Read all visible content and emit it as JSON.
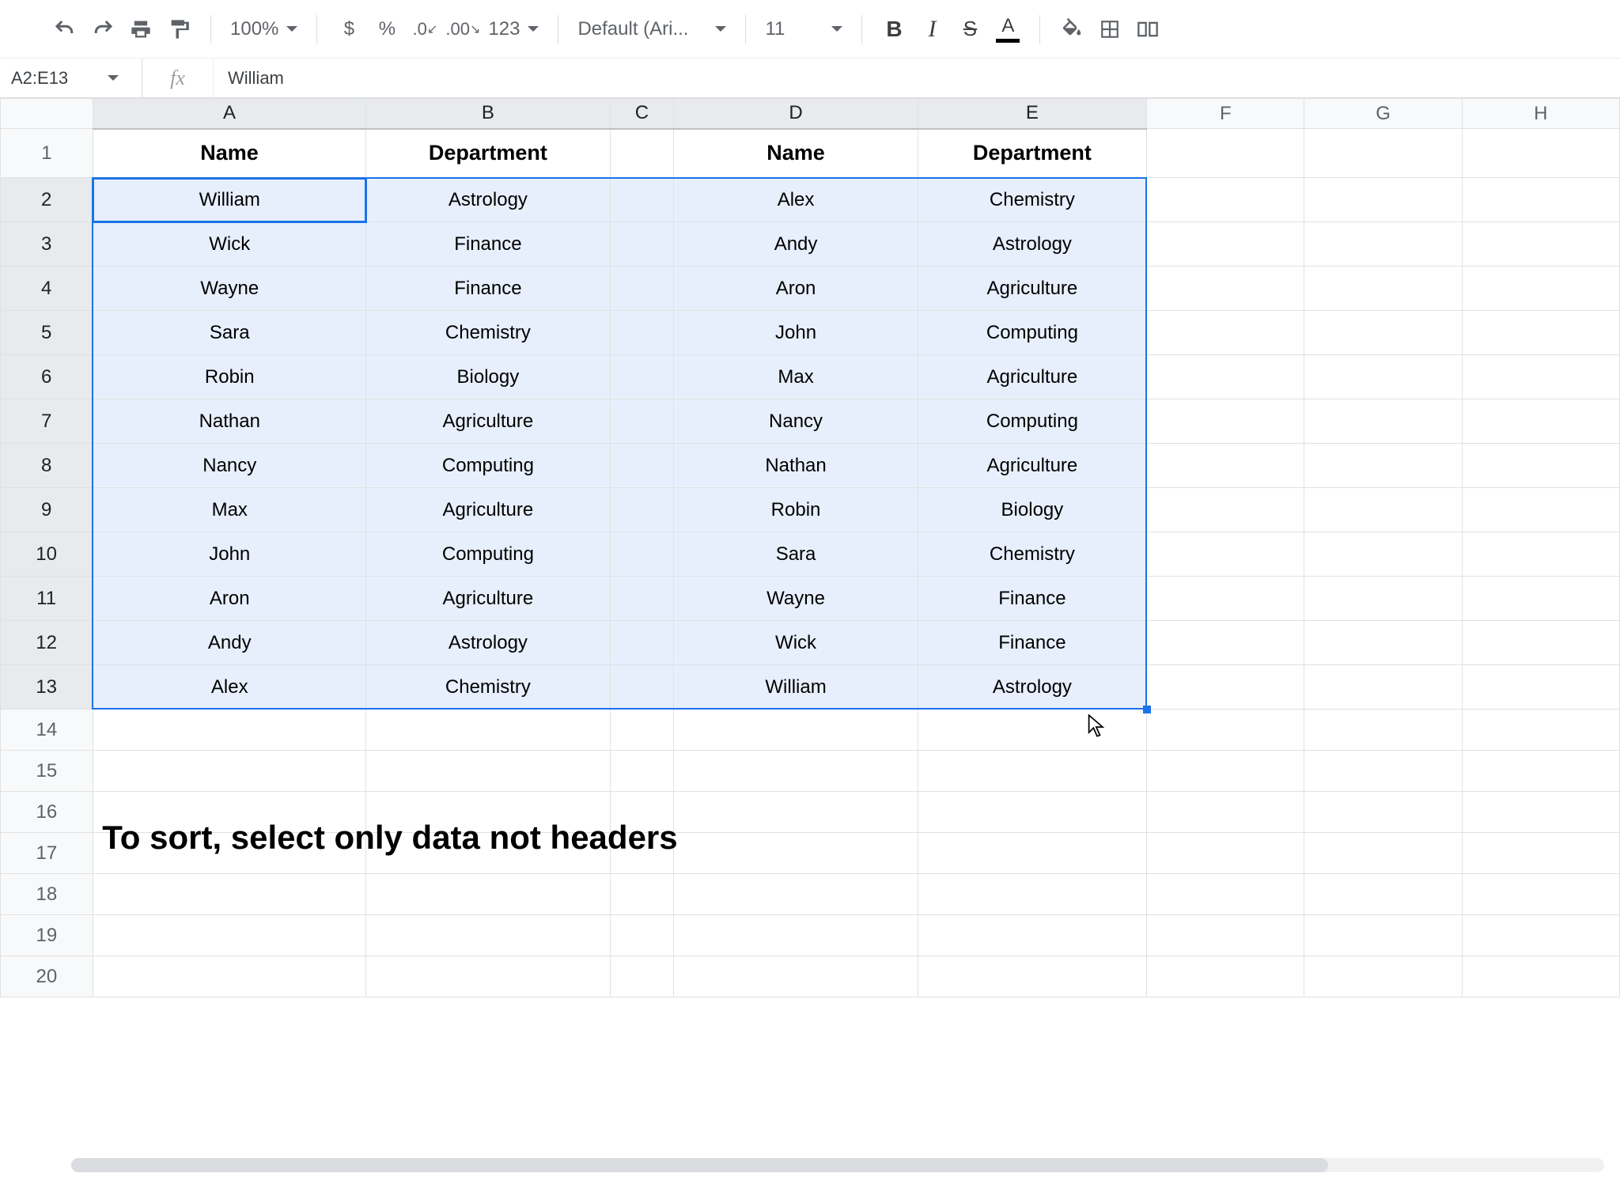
{
  "toolbar": {
    "zoom": "100%",
    "font": "Default (Ari...",
    "font_size": "11",
    "currency_symbol": "$",
    "percent_symbol": "%",
    "number_format_label": "123"
  },
  "namebox": {
    "value": "A2:E13"
  },
  "formula": {
    "value": "William",
    "fx": "fx"
  },
  "columns": [
    "A",
    "B",
    "C",
    "D",
    "E",
    "F",
    "G",
    "H"
  ],
  "column_widths": [
    "col-A",
    "col-B",
    "col-C",
    "col-D",
    "col-E",
    "col-rest",
    "col-rest",
    "col-rest"
  ],
  "selected_cols": [
    "A",
    "B",
    "C",
    "D",
    "E"
  ],
  "row_count": 20,
  "selected_rows": [
    2,
    3,
    4,
    5,
    6,
    7,
    8,
    9,
    10,
    11,
    12,
    13
  ],
  "active_cell": {
    "row": 2,
    "col": "A"
  },
  "headers_row": 1,
  "headers": {
    "A": "Name",
    "B": "Department",
    "D": "Name",
    "E": "Department"
  },
  "data": {
    "2": {
      "A": "William",
      "B": "Astrology",
      "D": "Alex",
      "E": "Chemistry"
    },
    "3": {
      "A": "Wick",
      "B": "Finance",
      "D": "Andy",
      "E": "Astrology"
    },
    "4": {
      "A": "Wayne",
      "B": "Finance",
      "D": "Aron",
      "E": "Agriculture"
    },
    "5": {
      "A": "Sara",
      "B": "Chemistry",
      "D": "John",
      "E": "Computing"
    },
    "6": {
      "A": "Robin",
      "B": "Biology",
      "D": "Max",
      "E": "Agriculture"
    },
    "7": {
      "A": "Nathan",
      "B": "Agriculture",
      "D": "Nancy",
      "E": "Computing"
    },
    "8": {
      "A": "Nancy",
      "B": "Computing",
      "D": "Nathan",
      "E": "Agriculture"
    },
    "9": {
      "A": "Max",
      "B": "Agriculture",
      "D": "Robin",
      "E": "Biology"
    },
    "10": {
      "A": "John",
      "B": "Computing",
      "D": "Sara",
      "E": "Chemistry"
    },
    "11": {
      "A": "Aron",
      "B": "Agriculture",
      "D": "Wayne",
      "E": "Finance"
    },
    "12": {
      "A": "Andy",
      "B": "Astrology",
      "D": "Wick",
      "E": "Finance"
    },
    "13": {
      "A": "Alex",
      "B": "Chemistry",
      "D": "William",
      "E": "Astrology"
    }
  },
  "annotation": "To sort, select only data not headers"
}
